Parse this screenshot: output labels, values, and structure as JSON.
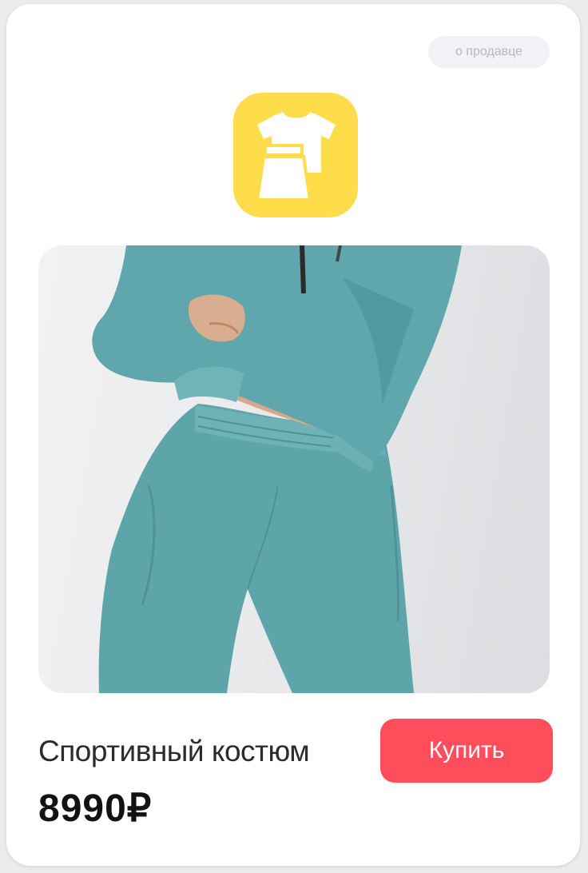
{
  "seller_chip": {
    "label": "о продавце"
  },
  "app_icon": {
    "icon": "clothes-icon",
    "background": "#ffdd4a"
  },
  "product": {
    "title": "Спортивный костюм",
    "price": "8990₽",
    "image_icon": "product-photo"
  },
  "buy_button": {
    "label": "Купить",
    "color": "#ff4e5b"
  }
}
